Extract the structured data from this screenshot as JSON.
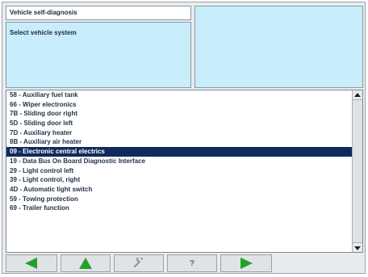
{
  "header": {
    "title": "Vehicle self-diagnosis",
    "prompt": "Select vehicle system"
  },
  "list": {
    "items": [
      {
        "label": "58 - Auxiliary fuel tank"
      },
      {
        "label": "66 - Wiper electronics"
      },
      {
        "label": "7B - Sliding door right"
      },
      {
        "label": "5D - Sliding door left"
      },
      {
        "label": "7D - Auxiliary heater"
      },
      {
        "label": "8B - Auxiliary air heater"
      },
      {
        "label": "09 - Electronic central electrics",
        "selected": true
      },
      {
        "label": "19 - Data Bus On Board Diagnostic Interface"
      },
      {
        "label": "29 - Light control left"
      },
      {
        "label": "39 - Light control, right"
      },
      {
        "label": "4D - Automatic light switch"
      },
      {
        "label": "59 - Towing protection"
      },
      {
        "label": "69 - Trailer function"
      }
    ]
  },
  "toolbar": {
    "help_label": "?"
  },
  "colors": {
    "panel_blue": "#c8eefb",
    "selection": "#102a5c",
    "arrow_green": "#22a12a"
  },
  "icons": {
    "back": "left-arrow-icon",
    "up": "up-arrow-icon",
    "tools": "wrench-icon",
    "help": "question-mark-icon",
    "forward": "right-arrow-icon"
  }
}
